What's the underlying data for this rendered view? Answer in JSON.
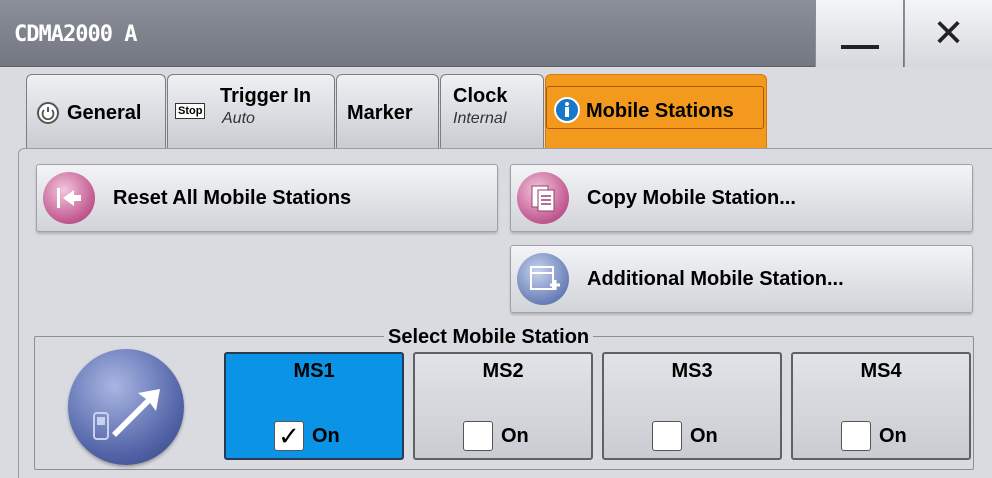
{
  "window": {
    "title": "CDMA2000 A",
    "minimize_label": "—",
    "close_label": "✕"
  },
  "tabs": [
    {
      "label": "General",
      "icon": "power-icon"
    },
    {
      "label": "Trigger In",
      "sub": "Auto",
      "badge": "Stop"
    },
    {
      "label": "Marker"
    },
    {
      "label": "Clock",
      "sub": "Internal"
    },
    {
      "label": "Mobile Stations",
      "icon": "info-icon",
      "active": true
    }
  ],
  "actions": {
    "reset": "Reset All Mobile Stations",
    "copy": "Copy Mobile Station...",
    "additional": "Additional Mobile Station..."
  },
  "select": {
    "legend": "Select Mobile Station",
    "stations": [
      {
        "name": "MS1",
        "state": "On",
        "checked": true,
        "selected": true
      },
      {
        "name": "MS2",
        "state": "On",
        "checked": false
      },
      {
        "name": "MS3",
        "state": "On",
        "checked": false
      },
      {
        "name": "MS4",
        "state": "On",
        "checked": false
      }
    ]
  },
  "colors": {
    "accent": "#f39a1e",
    "selected": "#0b93e6",
    "titlebar": "#7a7f89"
  }
}
